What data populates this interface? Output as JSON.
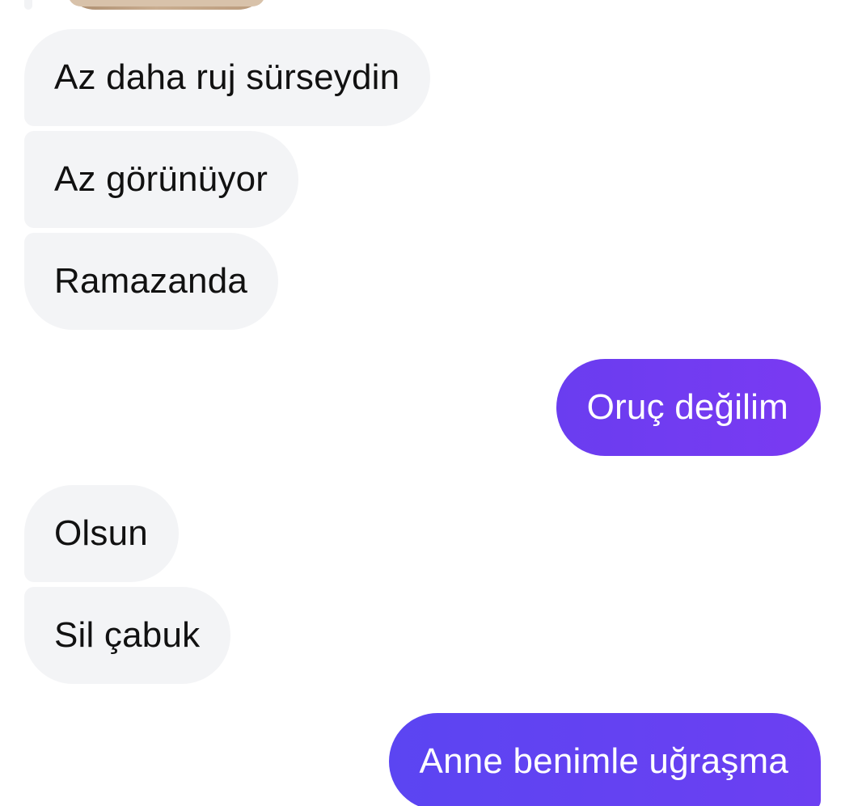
{
  "colors": {
    "incoming_bg": "#f3f4f6",
    "incoming_text": "#111111",
    "outgoing_bg": "#6a3df0",
    "outgoing_text": "#ffffff"
  },
  "messages": [
    {
      "direction": "incoming",
      "text": "Az daha ruj sürseydin"
    },
    {
      "direction": "incoming",
      "text": "Az görünüyor"
    },
    {
      "direction": "incoming",
      "text": "Ramazanda"
    },
    {
      "direction": "outgoing",
      "text": "Oruç değilim"
    },
    {
      "direction": "incoming",
      "text": "Olsun"
    },
    {
      "direction": "incoming",
      "text": "Sil çabuk"
    },
    {
      "direction": "outgoing",
      "text": "Anne benimle uğraşma"
    }
  ]
}
